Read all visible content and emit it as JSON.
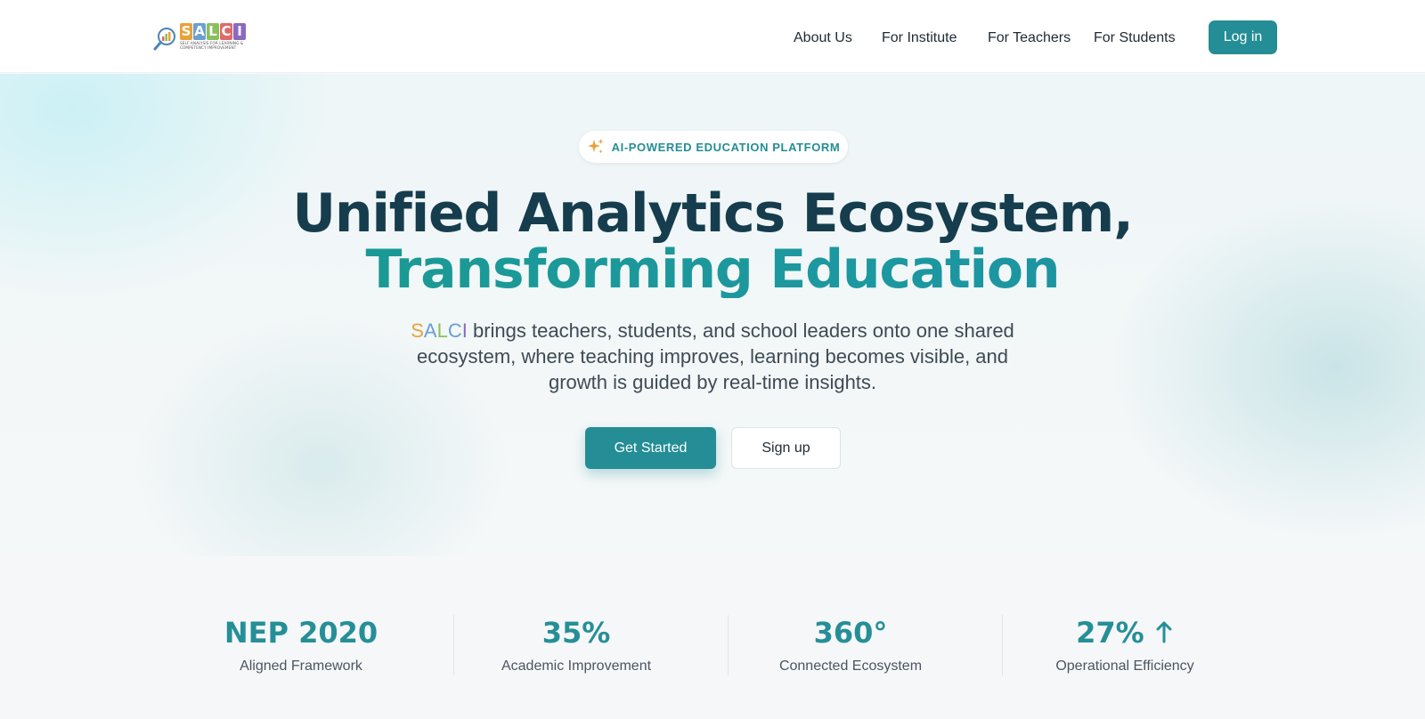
{
  "header": {
    "logo": {
      "letters": [
        "S",
        "A",
        "L",
        "C",
        "I"
      ],
      "tagline": "SELF ANALYSIS FOR LEARNING & COMPETENCY IMPROVEMENT",
      "letter_colors": [
        "#e8a23a",
        "#6a9fd4",
        "#8bbf5a",
        "#e06a6a",
        "#8a6ac0"
      ]
    },
    "nav": {
      "about": "About Us",
      "institute": "For Institute",
      "teachers": "For Teachers",
      "students": "For Students"
    },
    "login_label": "Log in"
  },
  "hero": {
    "badge": {
      "icon": "sparkle-icon",
      "text": "AI-POWERED EDUCATION PLATFORM"
    },
    "headline_line1": "Unified Analytics Ecosystem,",
    "headline_line2": "Transforming Education",
    "brand": [
      "S",
      "A",
      "L",
      "C",
      "I"
    ],
    "description": " brings teachers, students, and school leaders onto one shared ecosystem, where teaching improves, learning becomes visible, and growth is guided by real-time insights.",
    "get_started_label": "Get Started",
    "signup_label": "Sign up"
  },
  "stats": [
    {
      "value": "NEP 2020",
      "label": "Aligned Framework"
    },
    {
      "value": "35%",
      "label": "Academic Improvement"
    },
    {
      "value": "360°",
      "label": "Connected Ecosystem"
    },
    {
      "value": "27%",
      "label": "Operational Efficiency",
      "icon": "arrow-up-icon"
    }
  ],
  "colors": {
    "accent": "#248d95",
    "headline_dark": "#163d4d",
    "headline_teal": "#1a9a94"
  }
}
